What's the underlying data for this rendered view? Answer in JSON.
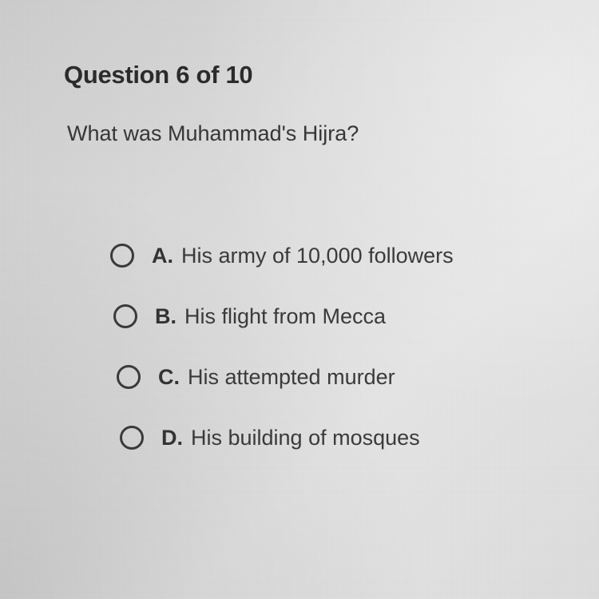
{
  "quiz": {
    "header": "Question 6 of 10",
    "question": "What was Muhammad's Hijra?",
    "options": [
      {
        "letter": "A.",
        "text": "His army of 10,000 followers"
      },
      {
        "letter": "B.",
        "text": "His flight from Mecca"
      },
      {
        "letter": "C.",
        "text": "His attempted murder"
      },
      {
        "letter": "D.",
        "text": "His building of mosques"
      }
    ]
  },
  "colors": {
    "background": "#d6d6d6",
    "text": "#2e2e2e",
    "radio_border": "#3a3a3a"
  }
}
